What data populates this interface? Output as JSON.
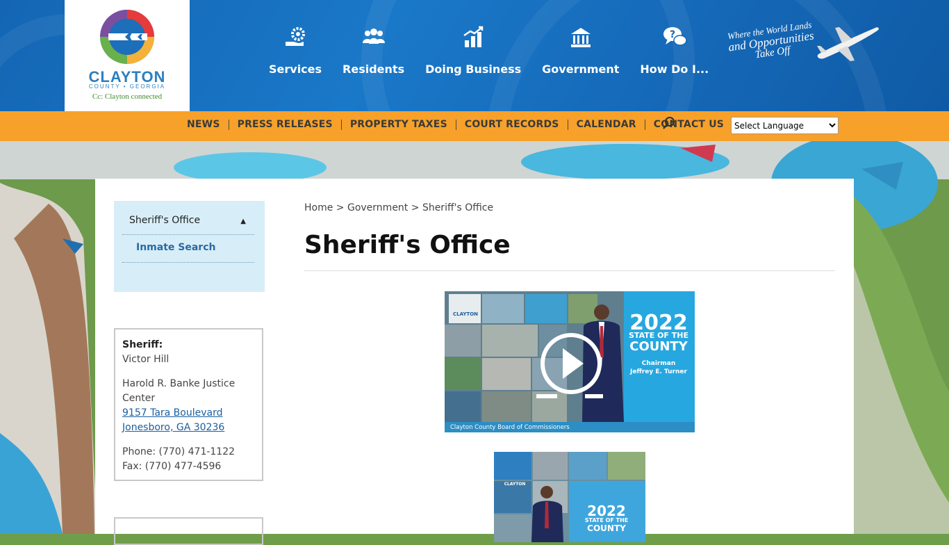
{
  "header": {
    "logo": {
      "name": "CLAYTON",
      "sub": "COUNTY • GEORGIA",
      "tagline": "Cc: Clayton connected"
    },
    "nav": [
      {
        "label": "Services",
        "icon": "gear-hand-icon"
      },
      {
        "label": "Residents",
        "icon": "people-icon"
      },
      {
        "label": "Doing Business",
        "icon": "bar-chart-icon"
      },
      {
        "label": "Government",
        "icon": "capitol-building-icon"
      },
      {
        "label": "How Do I...",
        "icon": "question-chat-icon"
      }
    ],
    "slogan": {
      "line1": "Where the World Lands",
      "line2": "and Opportunities",
      "line3": "Take Off"
    }
  },
  "subnav": {
    "links": [
      "NEWS",
      "PRESS RELEASES",
      "PROPERTY TAXES",
      "COURT RECORDS",
      "CALENDAR",
      "CONTACT US"
    ],
    "language_select": "Select Language"
  },
  "sidebar": {
    "menu_title": "Sheriff's Office",
    "menu_items": [
      "Inmate Search"
    ],
    "info": {
      "sheriff_label": "Sheriff:",
      "sheriff_name": "Victor Hill",
      "building_name": "Harold R. Banke Justice Center",
      "street": "9157 Tara Boulevard",
      "city": "Jonesboro, GA 30236",
      "phone": "Phone: (770) 471-1122",
      "fax": "Fax: (770) 477-4596"
    }
  },
  "main": {
    "breadcrumb": [
      "Home",
      "Government",
      "Sheriff's Office"
    ],
    "breadcrumb_sep": ">",
    "title": "Sheriff's Office",
    "video1": {
      "year": "2022",
      "heading1": "STATE OF THE",
      "heading2": "COUNTY",
      "chair1": "Chairman",
      "chair2": "Jeffrey E. Turner",
      "footer": "Clayton County Board of Commissioners",
      "logo": "CLAYTON"
    },
    "video2": {
      "year": "2022",
      "heading1": "STATE OF THE",
      "heading2": "COUNTY",
      "logo": "CLAYTON"
    }
  },
  "colors": {
    "header_blue": "#1466b4",
    "subnav_orange": "#f7a12a",
    "sidebar_bg": "#d7eef9",
    "link_blue": "#1a5fa0",
    "video_blue": "#27a7e0"
  }
}
